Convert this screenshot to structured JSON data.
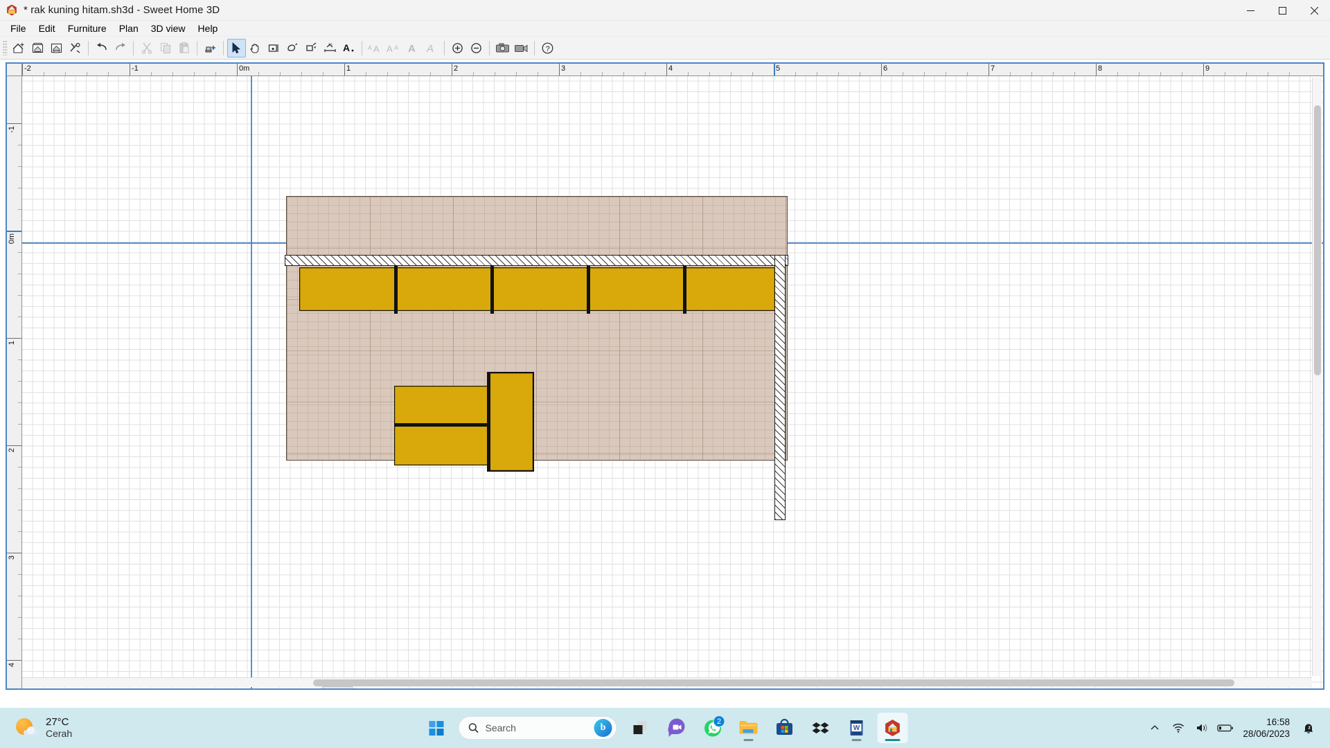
{
  "window": {
    "title": "* rak kuning hitam.sh3d - Sweet Home 3D",
    "app_icon": "sweet-home-3d-icon",
    "controls": {
      "minimize": "minimize-icon",
      "maximize": "maximize-icon",
      "close": "close-icon"
    }
  },
  "menubar": {
    "items": [
      {
        "label": "File"
      },
      {
        "label": "Edit"
      },
      {
        "label": "Furniture"
      },
      {
        "label": "Plan"
      },
      {
        "label": "3D view"
      },
      {
        "label": "Help"
      }
    ]
  },
  "toolbar": {
    "groups": [
      {
        "buttons": [
          {
            "name": "new-home-button",
            "icon": "new-home-icon",
            "enabled": true
          },
          {
            "name": "open-button",
            "icon": "open-folder-icon",
            "enabled": true
          },
          {
            "name": "save-button",
            "icon": "save-disk-icon",
            "enabled": true
          },
          {
            "name": "preferences-button",
            "icon": "preferences-tools-icon",
            "enabled": true
          }
        ]
      },
      {
        "buttons": [
          {
            "name": "undo-button",
            "icon": "undo-arrow-icon",
            "enabled": true
          },
          {
            "name": "redo-button",
            "icon": "redo-arrow-icon",
            "enabled": true
          }
        ]
      },
      {
        "buttons": [
          {
            "name": "cut-button",
            "icon": "scissors-icon",
            "enabled": false
          },
          {
            "name": "copy-button",
            "icon": "copy-icon",
            "enabled": false
          },
          {
            "name": "paste-button",
            "icon": "paste-icon",
            "enabled": false
          }
        ]
      },
      {
        "buttons": [
          {
            "name": "add-furniture-button",
            "icon": "add-furniture-icon",
            "enabled": true
          }
        ]
      },
      {
        "buttons": [
          {
            "name": "select-mode-button",
            "icon": "arrow-cursor-icon",
            "enabled": true,
            "selected": true
          },
          {
            "name": "pan-mode-button",
            "icon": "hand-pan-icon",
            "enabled": true
          },
          {
            "name": "create-walls-button",
            "icon": "create-walls-icon",
            "enabled": true
          },
          {
            "name": "create-rooms-button",
            "icon": "create-rooms-icon",
            "enabled": true
          },
          {
            "name": "create-polylines-button",
            "icon": "create-polyline-icon",
            "enabled": true
          },
          {
            "name": "create-dimensions-button",
            "icon": "create-dimension-icon",
            "enabled": true
          },
          {
            "name": "add-texts-button",
            "icon": "add-text-icon",
            "enabled": true
          }
        ]
      },
      {
        "buttons": [
          {
            "name": "increase-text-size-button",
            "icon": "increase-text-size-icon",
            "enabled": false
          },
          {
            "name": "decrease-text-size-button",
            "icon": "decrease-text-size-icon",
            "enabled": false
          },
          {
            "name": "toggle-bold-button",
            "icon": "bold-text-icon",
            "enabled": false
          },
          {
            "name": "toggle-italic-button",
            "icon": "italic-text-icon",
            "enabled": false
          }
        ]
      },
      {
        "buttons": [
          {
            "name": "zoom-in-button",
            "icon": "zoom-in-icon",
            "enabled": true
          },
          {
            "name": "zoom-out-button",
            "icon": "zoom-out-icon",
            "enabled": true
          }
        ]
      },
      {
        "buttons": [
          {
            "name": "create-photo-button",
            "icon": "camera-photo-icon",
            "enabled": true
          },
          {
            "name": "create-video-button",
            "icon": "video-camera-icon",
            "enabled": true
          }
        ]
      },
      {
        "buttons": [
          {
            "name": "help-button",
            "icon": "question-mark-help-icon",
            "enabled": true
          }
        ]
      }
    ]
  },
  "plan": {
    "horizontal_ruler": {
      "unit_label": "0m",
      "labels": [
        "-2",
        "-1",
        "0m",
        "1",
        "2",
        "3",
        "4",
        "5",
        "6",
        "7",
        "8",
        "9"
      ]
    },
    "vertical_ruler": {
      "labels": [
        "-1",
        "0m",
        "1",
        "2",
        "3",
        "4"
      ]
    },
    "room": {
      "name": "floor-room",
      "floor_color": "#d9c8bb"
    },
    "walls": [
      {
        "name": "wall-top"
      },
      {
        "name": "wall-right"
      }
    ],
    "furniture": [
      {
        "name": "shelf-top-1"
      },
      {
        "name": "shelf-top-2"
      },
      {
        "name": "shelf-top-3"
      },
      {
        "name": "shelf-top-4"
      },
      {
        "name": "shelf-top-5"
      },
      {
        "name": "shelf-center-upper"
      },
      {
        "name": "shelf-center-lower"
      },
      {
        "name": "shelf-center-vertical"
      }
    ],
    "colors": {
      "furniture": "#d9a90b",
      "furniture_outline": "#17150e",
      "selection": "#3a7bc8"
    }
  },
  "taskbar": {
    "weather": {
      "temperature": "27°C",
      "condition": "Cerah",
      "icon": "sun-cloud-icon"
    },
    "start": {
      "name": "start-button",
      "icon": "windows-logo-icon"
    },
    "search": {
      "placeholder": "Search",
      "icon": "search-icon",
      "assistant_icon": "bing-chat-icon"
    },
    "apps": [
      {
        "name": "task-view-button",
        "icon": "task-view-icon",
        "running": false,
        "badge": ""
      },
      {
        "name": "teams-chat-button",
        "icon": "teams-chat-icon",
        "running": false,
        "badge": ""
      },
      {
        "name": "whatsapp-button",
        "icon": "whatsapp-icon",
        "running": false,
        "badge": "2"
      },
      {
        "name": "file-explorer-button",
        "icon": "file-explorer-icon",
        "running": true,
        "badge": ""
      },
      {
        "name": "microsoft-store-button",
        "icon": "microsoft-store-icon",
        "running": false,
        "badge": ""
      },
      {
        "name": "dropbox-button",
        "icon": "dropbox-icon",
        "running": false,
        "badge": ""
      },
      {
        "name": "word-button",
        "icon": "microsoft-word-icon",
        "running": true,
        "badge": ""
      },
      {
        "name": "sweet-home-3d-button",
        "icon": "sweet-home-3d-icon",
        "running": true,
        "active": true,
        "badge": ""
      }
    ],
    "tray": {
      "overflow_icon": "chevron-up-icon",
      "wifi_icon": "wifi-icon",
      "volume_icon": "speaker-volume-icon",
      "battery_icon": "battery-icon",
      "time": "16:58",
      "date": "28/06/2023",
      "notifications_icon": "bell-do-not-disturb-icon"
    }
  }
}
